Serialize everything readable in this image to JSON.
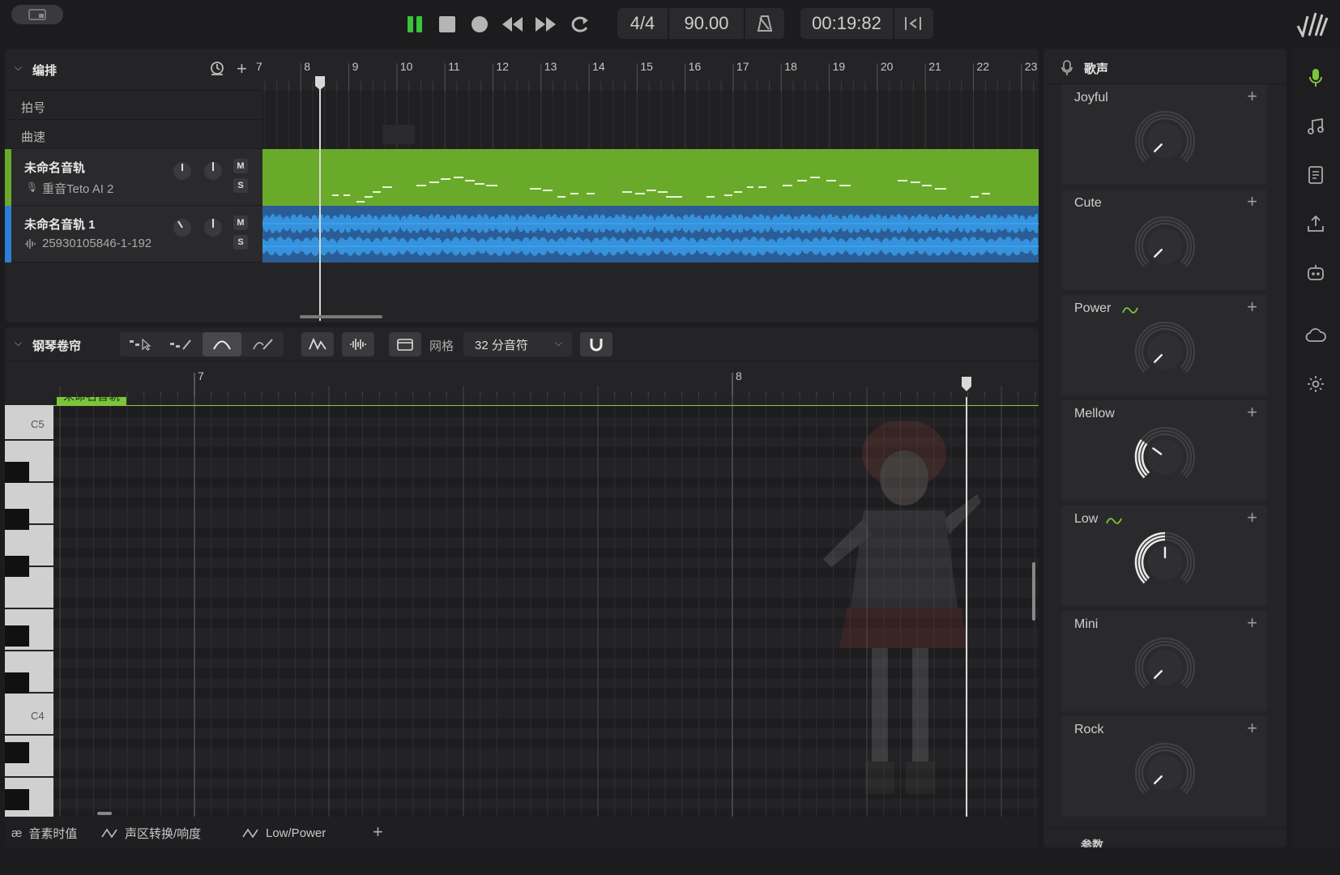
{
  "transport": {
    "time_signature": "4/4",
    "tempo": "90.00",
    "time_display": "00:19:82"
  },
  "arrangement": {
    "title": "编排",
    "ruler_numbers": [
      "7",
      "8",
      "9",
      "10",
      "11",
      "12",
      "13",
      "14",
      "15",
      "16",
      "17",
      "18",
      "19",
      "20",
      "21",
      "22",
      "23"
    ],
    "rows": {
      "beat": "拍号",
      "tempo": "曲速"
    },
    "tracks": [
      {
        "name": "未命名音轨",
        "sub": "重音Teto AI 2",
        "color": "#6aaa2a"
      },
      {
        "name": "未命名音轨 1",
        "sub": "25930105846-1-192",
        "color": "#2b7fd4"
      }
    ],
    "mute_label": "M",
    "solo_label": "S"
  },
  "piano_roll": {
    "title": "钢琴卷帘",
    "grid_label": "网格",
    "grid_value": "32 分音符",
    "ruler_numbers": [
      "7",
      "8"
    ],
    "track_tag": "未命名音轨",
    "keys": [
      "C5",
      "C4"
    ]
  },
  "bottom_tabs": [
    {
      "label": "音素时值",
      "icon": "phoneme-icon"
    },
    {
      "label": "声区转换/响度",
      "icon": "curve-icon"
    },
    {
      "label": "Low/Power",
      "icon": "curve-icon"
    }
  ],
  "voice_panel": {
    "title": "歌声",
    "styles": [
      {
        "name": "Joyful",
        "level": 0.0,
        "has_curve": false
      },
      {
        "name": "Cute",
        "level": 0.0,
        "has_curve": false
      },
      {
        "name": "Power",
        "level": 0.0,
        "has_curve": true
      },
      {
        "name": "Mellow",
        "level": 0.3,
        "has_curve": false
      },
      {
        "name": "Low",
        "level": 0.5,
        "has_curve": true
      },
      {
        "name": "Mini",
        "level": 0.0,
        "has_curve": false
      },
      {
        "name": "Rock",
        "level": 0.0,
        "has_curve": false
      }
    ],
    "footer_partial": "参数"
  },
  "colors": {
    "accent_green": "#7bc53a",
    "play_green": "#39c43a",
    "audio_blue": "#2b7fd4",
    "midi_green": "#6aaa2a"
  }
}
